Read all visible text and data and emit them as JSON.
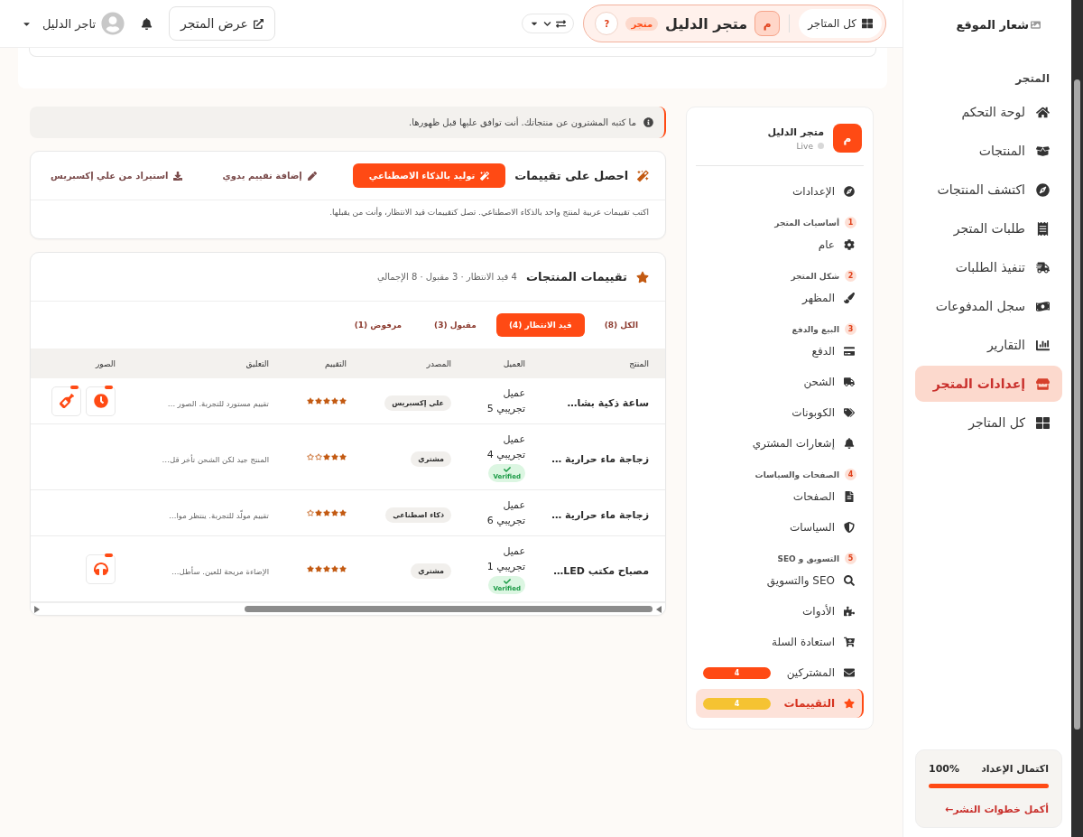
{
  "topbar": {
    "store_switcher": {
      "all_stores": "كل المتاجر",
      "avatar": "م",
      "store_name": "متجر الدليل",
      "badge": "متجر",
      "help": "?"
    },
    "view_store": "عرض المتجر",
    "user": "تاجر الدليل"
  },
  "sidebar": {
    "logo": "شعار الموقع",
    "section": "المتجر",
    "items": [
      {
        "label": "لوحة التحكم",
        "selected": false
      },
      {
        "label": "المنتجات",
        "selected": false
      },
      {
        "label": "اكتشف المنتجات",
        "selected": false
      },
      {
        "label": "طلبات المتجر",
        "selected": false
      },
      {
        "label": "تنفيذ الطلبات",
        "selected": false
      },
      {
        "label": "سجل المدفوعات",
        "selected": false
      },
      {
        "label": "التقارير",
        "selected": false
      },
      {
        "label": "إعدادات المتجر",
        "selected": true
      },
      {
        "label": "كل المتاجر",
        "selected": false
      }
    ],
    "setup": {
      "title": "اكتمال الإعداد",
      "value": "100%",
      "level": 1,
      "link": "أكمل خطوات النشر←"
    }
  },
  "notice": "ما كتبه المشترون عن منتجاتك. أنت توافق عليها قبل ظهورها.",
  "get_reviews": {
    "title": "احصل على تقييمات",
    "actions": [
      {
        "kind": "primary",
        "label": "توليد بالذكاء الاصطناعي"
      },
      {
        "kind": "manual",
        "label": "إضافة تقييم يدوي"
      },
      {
        "kind": "import",
        "label": "استيراد من علي إكسبريس"
      }
    ],
    "description": "اكتب تقييمات عربية لمنتج واحد بالذكاء الاصطناعي. تصل كتقييمات قيد الانتظار، وأنت من يقبلها."
  },
  "reviews": {
    "title": "تقييمات المنتجات",
    "summary": "4 قيد الانتظار · 3 مقبول · 8 الإجمالي",
    "tabs": [
      {
        "label": "الكل (8)",
        "selected": false
      },
      {
        "label": "قيد الانتظار (4)",
        "selected": true
      },
      {
        "label": "مقبول (3)",
        "selected": false
      },
      {
        "label": "مرفوض (1)",
        "selected": false
      }
    ],
    "columns": [
      "المنتج",
      "العميل",
      "المصدر",
      "التقييم",
      "التعليق",
      "الصور"
    ],
    "rows": [
      {
        "product": "ساعة ذكية بشا…",
        "customer": "عميل تجريبي 5",
        "verified": false,
        "source": "علي إكسبريس",
        "stars": 5,
        "comment": "تقييم مستورد للتجربة. الصور …",
        "images": [
          {
            "kind": "watch"
          },
          {
            "kind": "bottle"
          }
        ]
      },
      {
        "product": "زجاجة ماء حرارية …",
        "customer": "عميل تجريبي 4",
        "verified": true,
        "verified_label": "Verified",
        "source": "مشتري",
        "stars": 3,
        "comment": "المنتج جيد لكن الشحن تأخر قل…"
      },
      {
        "product": "زجاجة ماء حرارية …",
        "customer": "عميل تجريبي 6",
        "verified": false,
        "source": "ذكاء اصطناعي",
        "stars": 4,
        "comment": "تقييم مولّد للتجربة. ينتظر موا…"
      },
      {
        "product": "مصباح مكتب LED…",
        "customer": "عميل تجريبي 1",
        "verified": true,
        "verified_label": "Verified",
        "source": "مشتري",
        "stars": 5,
        "comment": "الإضاءة مريحة للعين. سأطل…",
        "images": [
          {
            "kind": "headphones"
          }
        ]
      }
    ]
  },
  "settings_nav": {
    "store": {
      "avatar": "م",
      "name": "متجر الدليل",
      "status": "Live"
    },
    "items": [
      {
        "kind": "link",
        "label": "الإعدادات",
        "selected": false
      },
      {
        "kind": "section",
        "number": "1",
        "title": "أساسيات المتجر",
        "children": [
          {
            "label": "عام",
            "selected": false
          }
        ]
      },
      {
        "kind": "section",
        "number": "2",
        "title": "شكل المتجر",
        "children": [
          {
            "label": "المظهر",
            "selected": false
          }
        ]
      },
      {
        "kind": "section",
        "number": "3",
        "title": "البيع والدفع",
        "children": [
          {
            "label": "الدفع",
            "selected": false
          },
          {
            "label": "الشحن",
            "selected": false
          },
          {
            "label": "الكوبونات",
            "selected": false
          },
          {
            "label": "إشعارات المشتري",
            "selected": false
          }
        ]
      },
      {
        "kind": "section",
        "number": "4",
        "title": "الصفحات والسياسات",
        "children": [
          {
            "label": "الصفحات",
            "selected": false
          },
          {
            "label": "السياسات",
            "selected": false
          }
        ]
      },
      {
        "kind": "section",
        "number": "5",
        "title": "التسويق و SEO",
        "children": [
          {
            "label": "SEO والتسويق",
            "selected": false
          },
          {
            "label": "الأدوات",
            "selected": false
          },
          {
            "label": "استعادة السلة",
            "selected": false
          },
          {
            "label": "المشتركين",
            "selected": false,
            "badge": "4",
            "color": "#ff4a14"
          },
          {
            "label": "التقييمات",
            "selected": true,
            "badge": "4",
            "color": "#f5c332"
          }
        ]
      }
    ]
  }
}
